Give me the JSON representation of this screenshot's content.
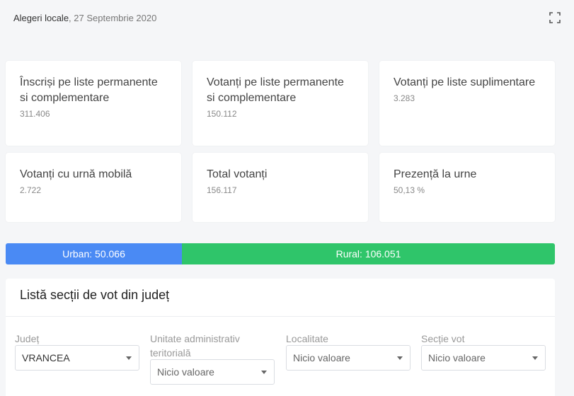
{
  "header": {
    "app_title": "Alegeri locale",
    "date": ", 27 Septembrie 2020"
  },
  "stats": [
    {
      "label": "Înscriși pe liste permanente si complementare",
      "value": "311.406"
    },
    {
      "label": "Votanți pe liste permanente si complementare",
      "value": "150.112"
    },
    {
      "label": "Votanți pe liste suplimentare",
      "value": "3.283"
    },
    {
      "label": "Votanți cu urnă mobilă",
      "value": "2.722"
    },
    {
      "label": "Total votanți",
      "value": "156.117"
    },
    {
      "label": "Prezență la urne",
      "value": "50,13 %"
    }
  ],
  "split": {
    "urban_label": "Urban: 50.066",
    "rural_label": "Rural: 106.051",
    "urban_color": "#4a8af4",
    "rural_color": "#2fc56a"
  },
  "panel": {
    "title": "Listă secții de vot din județ",
    "filters": [
      {
        "label": "Județ",
        "value": "VRANCEA"
      },
      {
        "label": "Unitate administrativ teritorială",
        "value": "Nicio valoare"
      },
      {
        "label": "Localitate",
        "value": "Nicio valoare"
      },
      {
        "label": "Secție vot",
        "value": "Nicio valoare"
      }
    ]
  },
  "icons": {
    "expand": "fullscreen-icon"
  }
}
